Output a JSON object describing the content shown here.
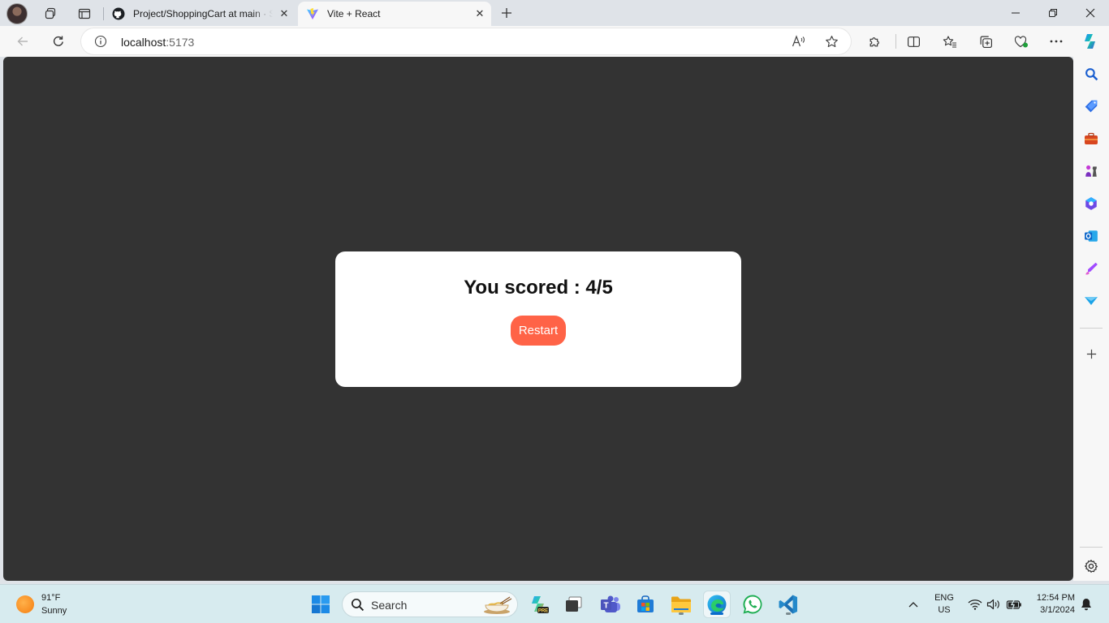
{
  "browser": {
    "tabs": [
      {
        "title": "Project/ShoppingCart at main · S",
        "icon": "github-icon",
        "active": false
      },
      {
        "title": "Vite + React",
        "icon": "vite-icon",
        "active": true
      }
    ],
    "address": {
      "host": "localhost",
      "port": ":5173"
    }
  },
  "page": {
    "score_text": "You scored : 4/5",
    "restart_label": "Restart",
    "background_color": "#333333",
    "button_color": "#ff6347"
  },
  "taskbar": {
    "weather": {
      "temp": "91°F",
      "condition": "Sunny"
    },
    "search_label": "Search",
    "language": {
      "line1": "ENG",
      "line2": "US"
    },
    "clock": {
      "time": "12:54 PM",
      "date": "3/1/2024"
    }
  }
}
